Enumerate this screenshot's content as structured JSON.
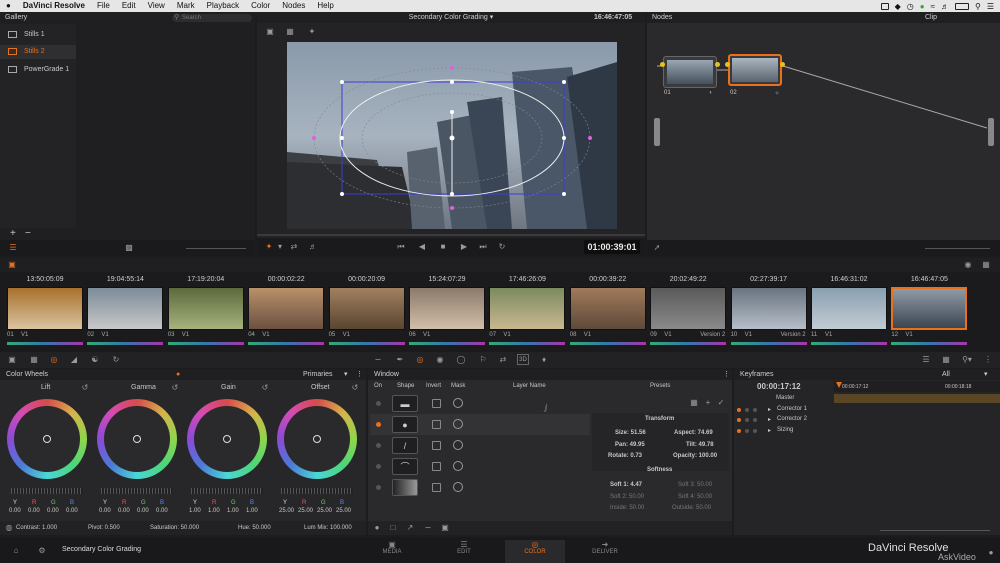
{
  "menubar": {
    "app": "DaVinci Resolve",
    "items": [
      "File",
      "Edit",
      "View",
      "Mark",
      "Playback",
      "Color",
      "Nodes",
      "Help"
    ],
    "right_icons": [
      "screen-icon",
      "dropbox-icon",
      "clock-icon",
      "evernote-icon",
      "wifi-icon",
      "volume-icon",
      "battery-icon",
      "spotlight-icon",
      "list-icon"
    ]
  },
  "gallery": {
    "title": "Gallery",
    "search": "Search",
    "items": [
      "Stills 1",
      "Stills 2",
      "PowerGrade 1"
    ],
    "add": "+",
    "remove": "−"
  },
  "viewer": {
    "title": "Secondary Color Grading",
    "timecode": "16:46:47:05",
    "transport_tc": "01:00:39:01"
  },
  "nodes": {
    "title": "Nodes",
    "clip_label": "Clip",
    "node1": "01",
    "node2": "02"
  },
  "timeline": {
    "clips": [
      {
        "tc": "13:50:05:09",
        "no": "01",
        "track": "V1",
        "label": ""
      },
      {
        "tc": "19:04:55:14",
        "no": "02",
        "track": "V1",
        "label": ""
      },
      {
        "tc": "17:19:20:04",
        "no": "03",
        "track": "V1",
        "label": ""
      },
      {
        "tc": "00:00:02:22",
        "no": "04",
        "track": "V1",
        "label": ""
      },
      {
        "tc": "00:00:20:09",
        "no": "05",
        "track": "V1",
        "label": ""
      },
      {
        "tc": "15:24:07:29",
        "no": "06",
        "track": "V1",
        "label": ""
      },
      {
        "tc": "17:46:26:09",
        "no": "07",
        "track": "V1",
        "label": ""
      },
      {
        "tc": "00:00:39:22",
        "no": "08",
        "track": "V1",
        "label": ""
      },
      {
        "tc": "20:02:49:22",
        "no": "09",
        "track": "V1",
        "label": "Version 2"
      },
      {
        "tc": "02:27:39:17",
        "no": "10",
        "track": "V1",
        "label": "Version 2"
      },
      {
        "tc": "16:46:31:02",
        "no": "11",
        "track": "V1",
        "label": ""
      },
      {
        "tc": "16:46:47:05",
        "no": "12",
        "track": "V1",
        "label": ""
      }
    ]
  },
  "color_wheels": {
    "title": "Color Wheels",
    "mode": "Primaries",
    "wheels": [
      {
        "name": "Lift",
        "Y": "0.00",
        "R": "0.00",
        "G": "0.00",
        "B": "0.00"
      },
      {
        "name": "Gamma",
        "Y": "0.00",
        "R": "0.00",
        "G": "0.00",
        "B": "0.00"
      },
      {
        "name": "Gain",
        "Y": "1.00",
        "R": "1.00",
        "G": "1.00",
        "B": "1.00"
      },
      {
        "name": "Offset",
        "Y": "25.00",
        "R": "25.00",
        "G": "25.00",
        "B": "25.00"
      }
    ],
    "footer": {
      "contrast": "Contrast: 1.000",
      "pivot": "Pivot: 0.500",
      "saturation": "Saturation: 50.000",
      "hue": "Hue: 50.000",
      "lum_mix": "Lum Mix: 100.000"
    }
  },
  "window_panel": {
    "title": "Window",
    "cols": [
      "On",
      "Shape",
      "Invert",
      "Mask",
      "Layer Name"
    ]
  },
  "presets": {
    "title": "Presets",
    "transform_title": "Transform",
    "size": "Size: 51.56",
    "aspect": "Aspect: 74.69",
    "pan": "Pan: 49.95",
    "tilt": "Tilt: 49.78",
    "rotate": "Rotate: 0.73",
    "opacity": "Opacity: 100.00",
    "softness_title": "Softness",
    "soft1": "Soft 1: 4.47",
    "soft2": "Soft 2: 50.00",
    "soft3": "Soft 3: 50.00",
    "soft4": "Soft 4: 50.00",
    "inside": "Inside: 50.00",
    "outside": "Outside: 50.00"
  },
  "keyframes": {
    "title": "Keyframes",
    "filter": "All",
    "tc": "00:00:17:12",
    "ruler_a": "00:00:17:12",
    "ruler_b": "00:00:18:18",
    "tracks": [
      "Master",
      "Corrector 1",
      "Corrector 2",
      "Sizing"
    ]
  },
  "bottom": {
    "project": "Secondary Color Grading",
    "tabs": [
      "MEDIA",
      "EDIT",
      "COLOR",
      "DELIVER"
    ],
    "brand": "DaVinci Resolve",
    "watermark": "AskVideo"
  },
  "colors": {
    "accent": "#e8711c",
    "bg": "#1c1c1e",
    "panel": "#262629"
  }
}
